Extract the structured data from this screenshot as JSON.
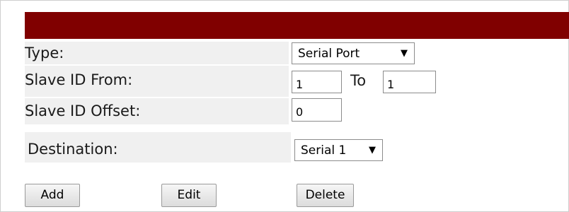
{
  "form": {
    "type_label": "Type:",
    "type_value": "Serial Port",
    "slave_id_from_label": "Slave ID From:",
    "slave_id_from_value": "1",
    "to_label": "To",
    "slave_id_to_value": "1",
    "slave_id_offset_label": "Slave ID Offset:",
    "slave_id_offset_value": "0",
    "destination_label": "Destination:",
    "destination_value": "Serial 1"
  },
  "buttons": {
    "add_label": "Add",
    "edit_label": "Edit",
    "delete_label": "Delete"
  },
  "icons": {
    "dropdown_arrow": "▼"
  },
  "colors": {
    "header_bar": "#800000",
    "label_background": "#f0f0f0"
  }
}
